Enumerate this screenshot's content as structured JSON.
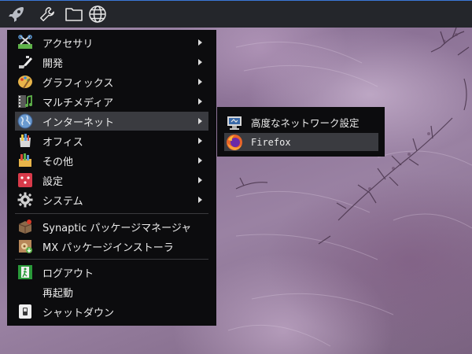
{
  "panel": {
    "icons": [
      "rocket-icon",
      "wrench-icon",
      "folder-icon",
      "globe-icon"
    ],
    "accent": "#3a78d8"
  },
  "menu": {
    "items": [
      {
        "label": "アクセサリ",
        "icon": "accessories-icon",
        "submenu": true
      },
      {
        "label": "開発",
        "icon": "development-icon",
        "submenu": true
      },
      {
        "label": "グラフィックス",
        "icon": "graphics-icon",
        "submenu": true
      },
      {
        "label": "マルチメディア",
        "icon": "multimedia-icon",
        "submenu": true
      },
      {
        "label": "インターネット",
        "icon": "internet-icon",
        "submenu": true,
        "active": true
      },
      {
        "label": "オフィス",
        "icon": "office-icon",
        "submenu": true
      },
      {
        "label": "その他",
        "icon": "other-icon",
        "submenu": true
      },
      {
        "label": "設定",
        "icon": "settings-icon",
        "submenu": true
      },
      {
        "label": "システム",
        "icon": "system-icon",
        "submenu": true
      },
      {
        "label": "Synaptic パッケージマネージャ",
        "icon": "synaptic-icon",
        "submenu": false
      },
      {
        "label": "MX パッケージインストーラ",
        "icon": "mx-installer-icon",
        "submenu": false
      },
      {
        "label": "ログアウト",
        "icon": "logout-icon",
        "submenu": false
      },
      {
        "label": "再起動",
        "icon": "",
        "submenu": false
      },
      {
        "label": "シャットダウン",
        "icon": "shutdown-icon",
        "submenu": false
      }
    ]
  },
  "submenu": {
    "items": [
      {
        "label": "高度なネットワーク設定",
        "icon": "network-settings-icon"
      },
      {
        "label": "Firefox",
        "icon": "firefox-icon",
        "active": true
      }
    ]
  }
}
